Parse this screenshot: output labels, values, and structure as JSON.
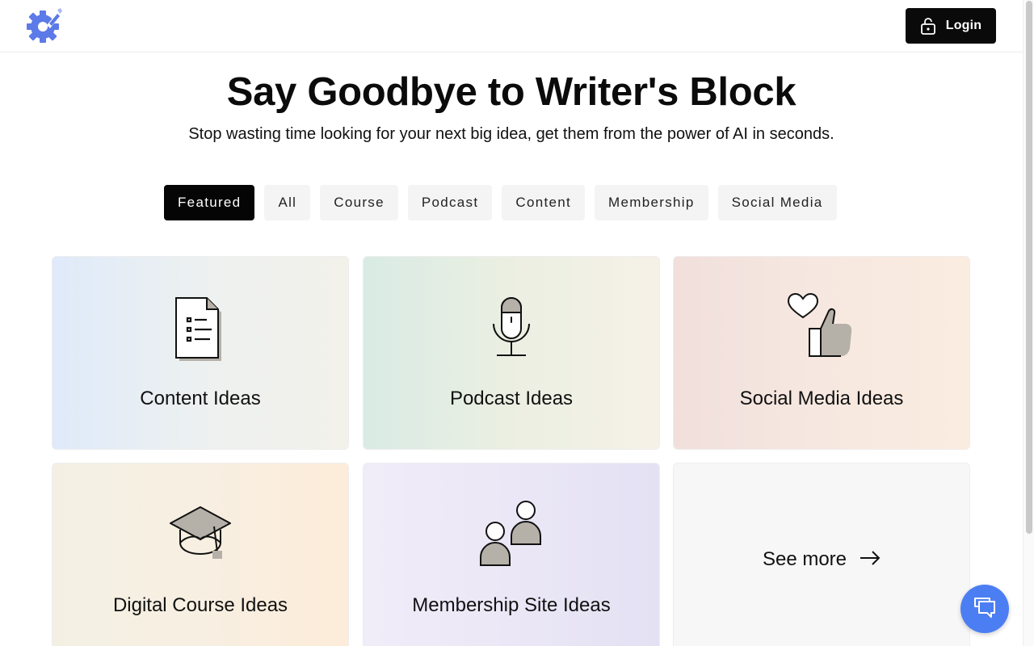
{
  "header": {
    "login_label": "Login",
    "logo_icon": "gear-pencil-logo-icon",
    "brand_color": "#5c7ae8"
  },
  "hero": {
    "title": "Say Goodbye to Writer's Block",
    "subtitle": "Stop wasting time looking for your next big idea, get them from the power of AI in seconds."
  },
  "tabs": [
    {
      "label": "Featured",
      "active": true
    },
    {
      "label": "All",
      "active": false
    },
    {
      "label": "Course",
      "active": false
    },
    {
      "label": "Podcast",
      "active": false
    },
    {
      "label": "Content",
      "active": false
    },
    {
      "label": "Membership",
      "active": false
    },
    {
      "label": "Social Media",
      "active": false
    }
  ],
  "cards": [
    {
      "label": "Content Ideas",
      "icon": "document-list-icon"
    },
    {
      "label": "Podcast Ideas",
      "icon": "microphone-icon"
    },
    {
      "label": "Social Media Ideas",
      "icon": "heart-thumbs-up-icon"
    },
    {
      "label": "Digital Course Ideas",
      "icon": "graduation-cap-icon"
    },
    {
      "label": "Membership Site Ideas",
      "icon": "people-icon"
    }
  ],
  "see_more": {
    "label": "See more",
    "icon": "arrow-right-icon"
  },
  "chat": {
    "icon": "chat-bubbles-icon",
    "color": "#4c7ef3"
  }
}
